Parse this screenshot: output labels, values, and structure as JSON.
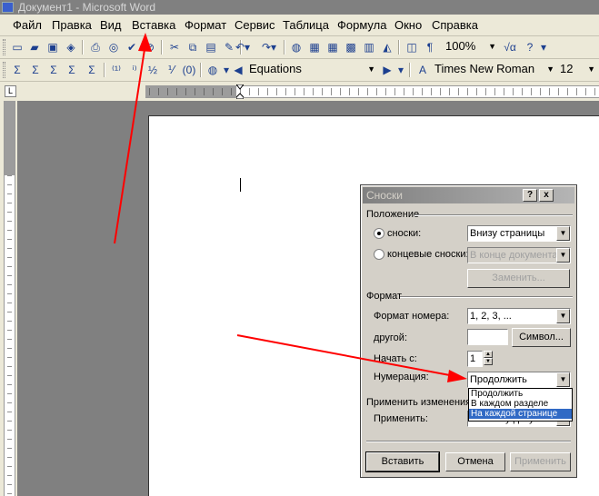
{
  "window": {
    "title": "Документ1 - Microsoft Word"
  },
  "menu": [
    "Файл",
    "Правка",
    "Вид",
    "Вставка",
    "Формат",
    "Сервис",
    "Таблица",
    "Формула",
    "Окно",
    "Справка"
  ],
  "toolbar": {
    "zoom": "100%",
    "style": "Equations",
    "font": "Times New Roman",
    "size": "12"
  },
  "dialog": {
    "title": "Сноски",
    "help": "?",
    "close": "x",
    "section_position": "Положение",
    "footnotes_label": "сноски:",
    "footnotes_value": "Внизу страницы",
    "endnotes_label": "концевые сноски:",
    "endnotes_value": "В конце документа",
    "replace_button": "Заменить...",
    "section_format": "Формат",
    "number_format_label": "Формат номера:",
    "number_format_value": "1, 2, 3, ...",
    "custom_label": "другой:",
    "custom_value": "",
    "symbol_button": "Символ...",
    "start_label": "Начать с:",
    "start_value": "1",
    "numbering_label": "Нумерация:",
    "numbering_value": "Продолжить",
    "numbering_options": [
      "Продолжить",
      "В каждом разделе",
      "На каждой странице"
    ],
    "numbering_selected_option": "На каждой странице",
    "section_apply": "Применить изменения",
    "apply_label": "Применить:",
    "apply_value": "ко всему документу",
    "insert_button": "Вставить",
    "cancel_button": "Отмена",
    "apply_button": "Применить"
  },
  "colors": {
    "annotation_arrow": "#ff0000",
    "workspace": "#808080",
    "list_highlight": "#316ac5"
  }
}
